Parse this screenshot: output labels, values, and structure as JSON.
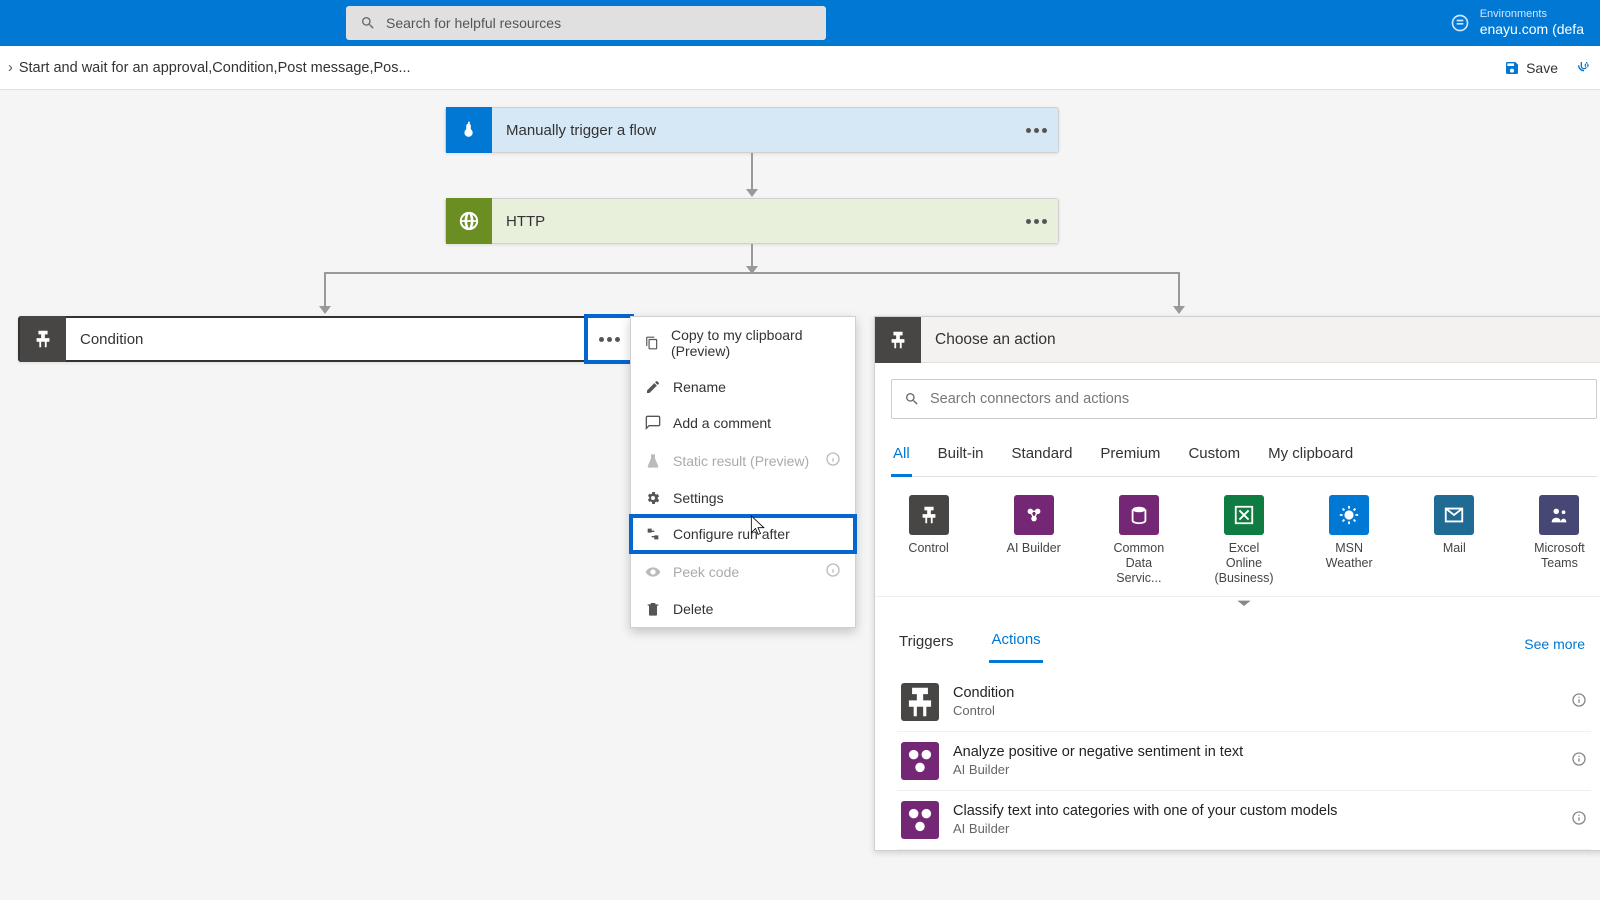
{
  "header": {
    "search_placeholder": "Search for helpful resources",
    "env_label": "Environments",
    "env_value": "enayu.com (defa"
  },
  "subbar": {
    "breadcrumb": "Start and wait for an approval,Condition,Post message,Pos...",
    "save": "Save"
  },
  "cards": {
    "trigger": "Manually trigger a flow",
    "http": "HTTP",
    "condition": "Condition"
  },
  "menu": {
    "copy": "Copy to my clipboard (Preview)",
    "rename": "Rename",
    "comment": "Add a comment",
    "static": "Static result (Preview)",
    "settings": "Settings",
    "configure": "Configure run after",
    "peek": "Peek code",
    "delete": "Delete"
  },
  "choose": {
    "title": "Choose an action",
    "search_placeholder": "Search connectors and actions",
    "tabs": [
      "All",
      "Built-in",
      "Standard",
      "Premium",
      "Custom",
      "My clipboard"
    ],
    "connectors": [
      {
        "name": "Control",
        "color": "#484644"
      },
      {
        "name": "AI Builder",
        "color": "#742774"
      },
      {
        "name": "Common Data Servic...",
        "color": "#742774"
      },
      {
        "name": "Excel Online (Business)",
        "color": "#107c41"
      },
      {
        "name": "MSN Weather",
        "color": "#0078d4"
      },
      {
        "name": "Mail",
        "color": "#1f6b94"
      },
      {
        "name": "Microsoft Teams",
        "color": "#464775"
      }
    ],
    "triggers": "Triggers",
    "actions": "Actions",
    "seemore": "See more",
    "list": [
      {
        "title": "Condition",
        "sub": "Control",
        "color": "#484644"
      },
      {
        "title": "Analyze positive or negative sentiment in text",
        "sub": "AI Builder",
        "color": "#742774"
      },
      {
        "title": "Classify text into categories with one of your custom models",
        "sub": "AI Builder",
        "color": "#742774"
      }
    ]
  }
}
